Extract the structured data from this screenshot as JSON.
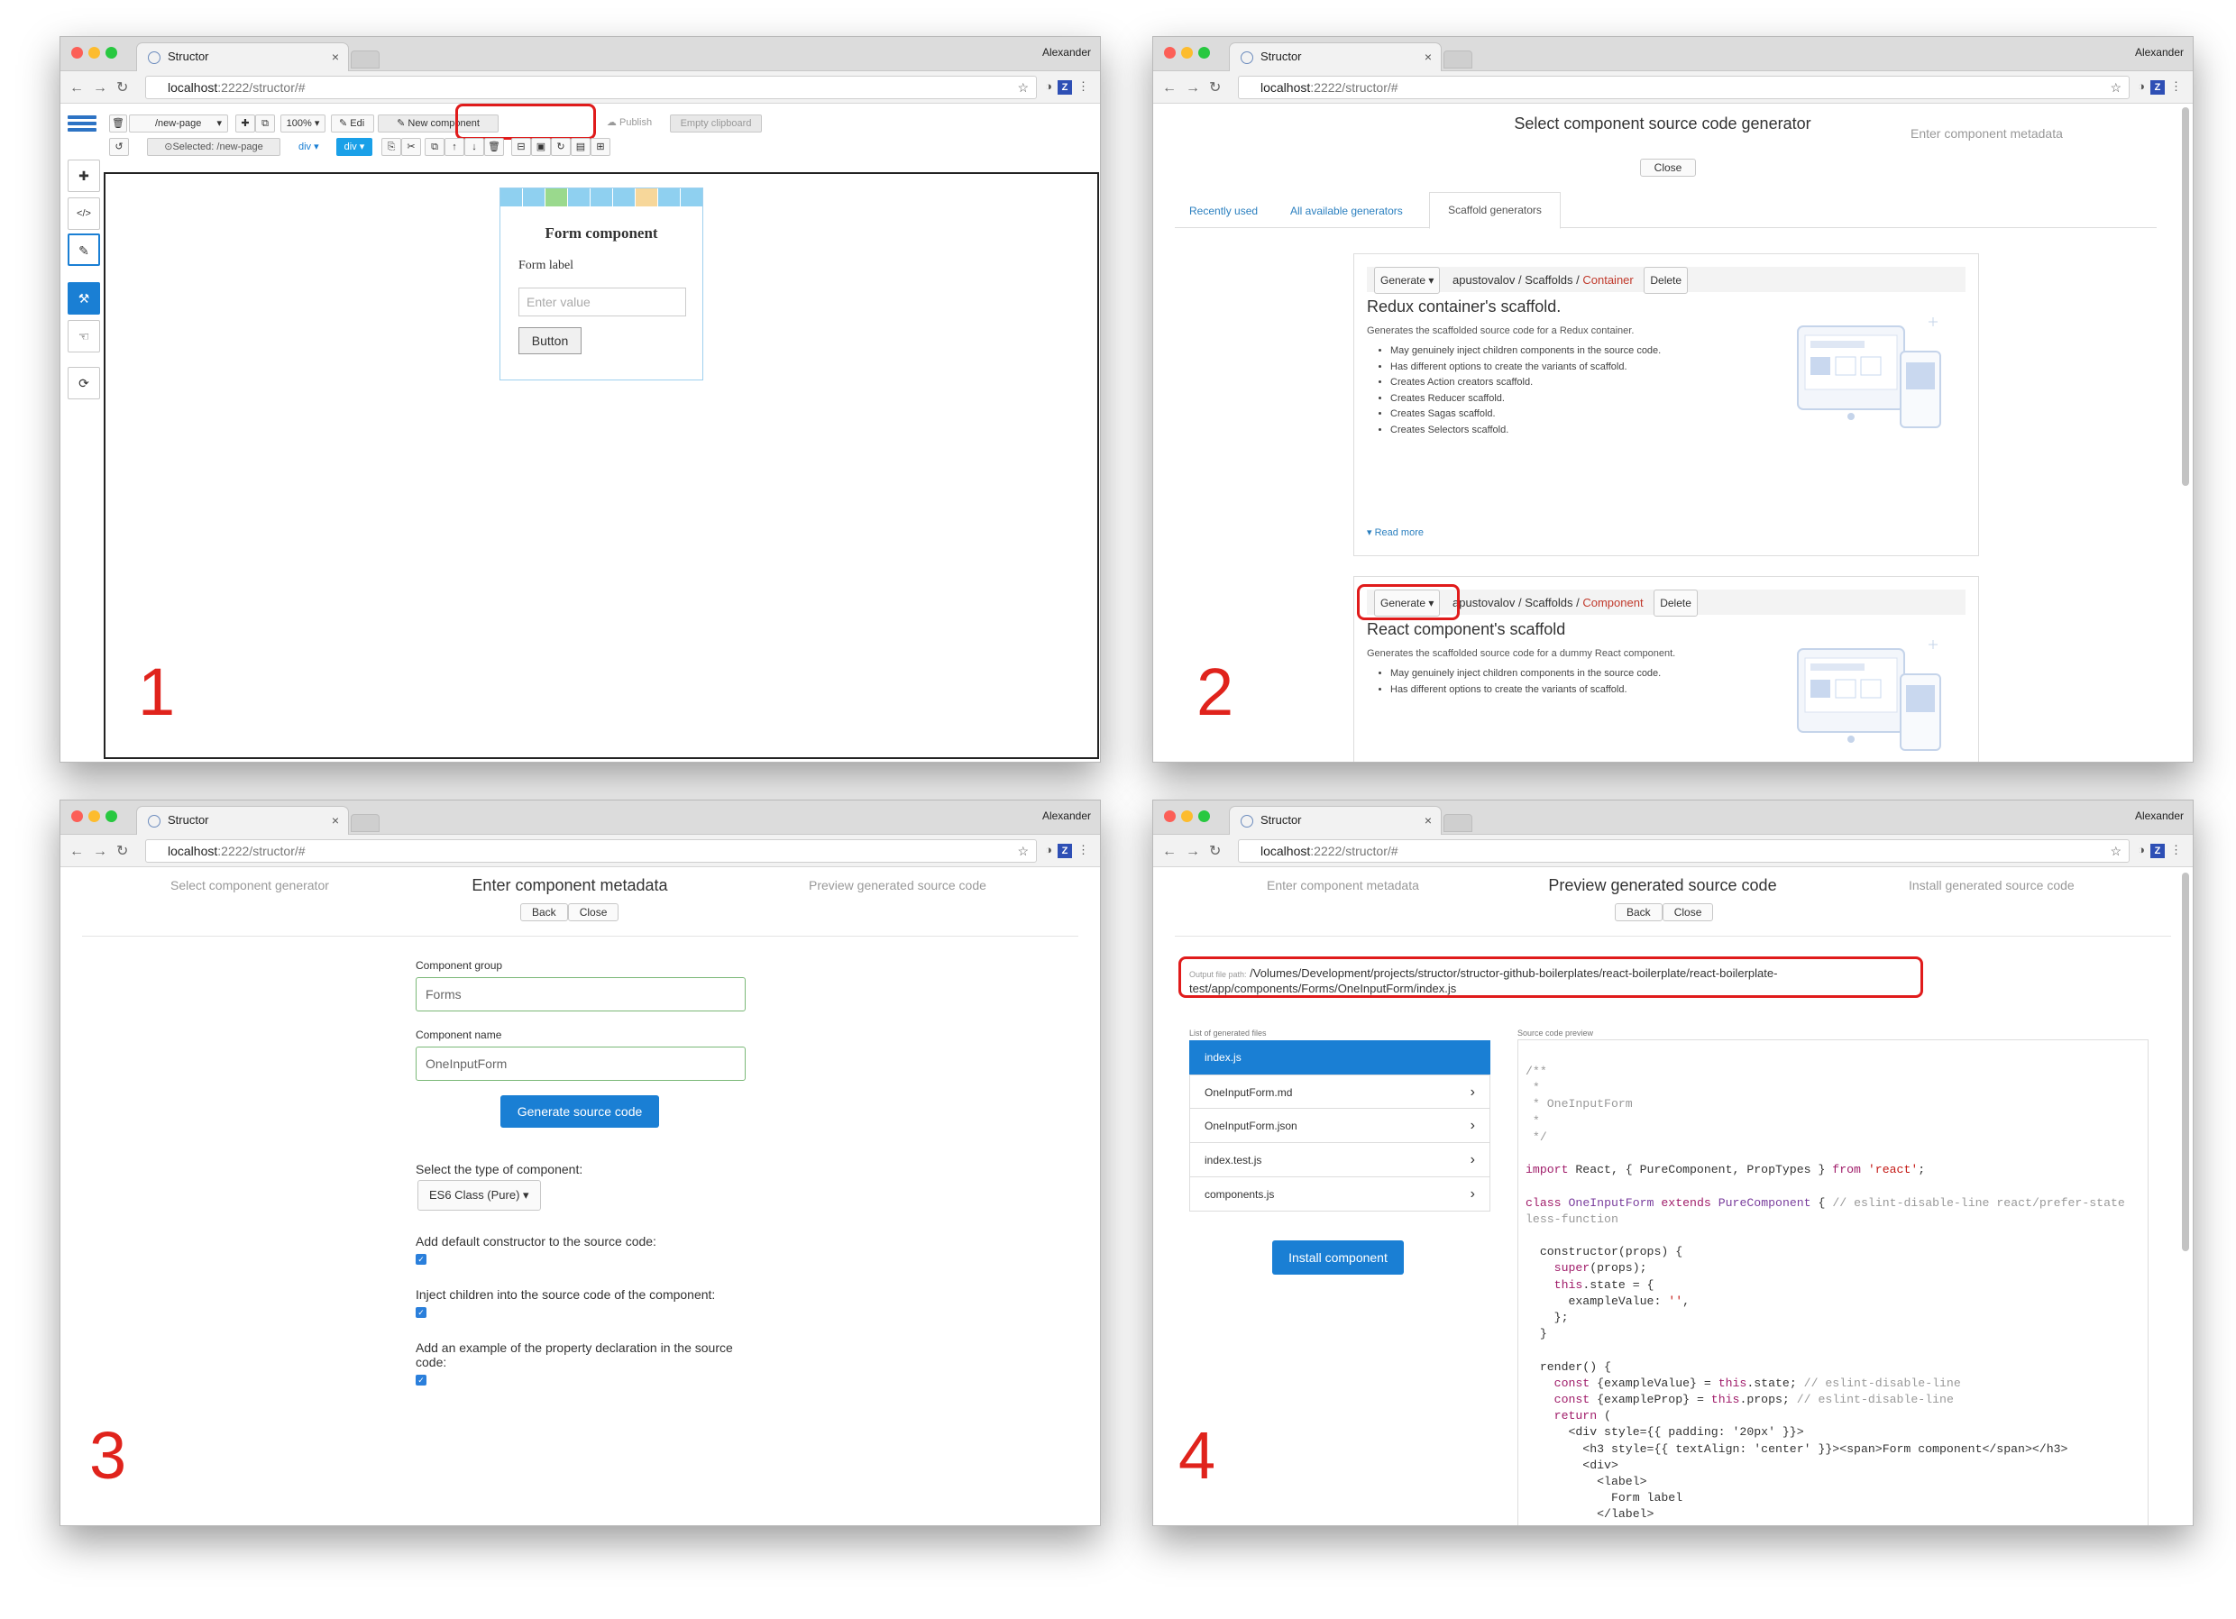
{
  "browser": {
    "tab_title": "Structor",
    "user": "Alexander",
    "url_host": "localhost",
    "url_path": ":2222/structor/#"
  },
  "step_numbers": [
    "1",
    "2",
    "3",
    "4"
  ],
  "window1": {
    "page_select": "/new-page",
    "zoom": "100%",
    "edit_label": "Edi",
    "new_component_label": "New component",
    "publish_label": "Publish",
    "empty_clipboard_label": "Empty clipboard",
    "selected_label": "Selected:",
    "selected_value": "/new-page",
    "crumb_div": "div",
    "crumb_div_active": "div",
    "form": {
      "title": "Form component",
      "label": "Form label",
      "placeholder": "Enter value",
      "button": "Button"
    }
  },
  "window2": {
    "header": {
      "title": "Select component source code generator",
      "next_step": "Enter component metadata",
      "close": "Close"
    },
    "tabs": [
      "Recently used",
      "All available generators",
      "Scaffold generators"
    ],
    "cards": [
      {
        "generate": "Generate",
        "owner": "apustovalov",
        "repo": "Scaffolds",
        "name": "Container",
        "delete": "Delete",
        "title": "Redux container's scaffold.",
        "desc": "Generates the scaffolded source code for a Redux container.",
        "bullets": [
          "May genuinely inject children components in the source code.",
          "Has different options to create the variants of scaffold.",
          "Creates Action creators scaffold.",
          "Creates Reducer scaffold.",
          "Creates Sagas scaffold.",
          "Creates Selectors scaffold."
        ],
        "read_more": "Read more"
      },
      {
        "generate": "Generate",
        "owner": "apustovalov",
        "repo": "Scaffolds",
        "name": "Component",
        "delete": "Delete",
        "title": "React component's scaffold",
        "desc": "Generates the scaffolded source code for a dummy React component.",
        "bullets": [
          "May genuinely inject children components in the source code.",
          "Has different options to create the variants of scaffold."
        ]
      }
    ]
  },
  "window3": {
    "header": {
      "prev_step": "Select component generator",
      "title": "Enter component metadata",
      "next_step": "Preview generated source code",
      "back": "Back",
      "close": "Close"
    },
    "group_label": "Component group",
    "group_value": "Forms",
    "name_label": "Component name",
    "name_value": "OneInputForm",
    "generate_button": "Generate source code",
    "type_label": "Select the type of component:",
    "type_value": "ES6 Class (Pure)",
    "opt1": "Add default constructor to the source code:",
    "opt2": "Inject children into the source code of the component:",
    "opt3": "Add an example of the property declaration in the source code:"
  },
  "window4": {
    "header": {
      "prev_step": "Enter component metadata",
      "title": "Preview generated source code",
      "next_step": "Install generated source code",
      "back": "Back",
      "close": "Close"
    },
    "output_label": "Output file path:",
    "output_path": "/Volumes/Development/projects/structor/structor-github-boilerplates/react-boilerplate/react-boilerplate-test/app/components/Forms/OneInputForm/index.js",
    "files_label": "List of generated files",
    "files": [
      "index.js",
      "OneInputForm.md",
      "OneInputForm.json",
      "index.test.js",
      "components.js"
    ],
    "preview_label": "Source code preview",
    "install_button": "Install component"
  },
  "colors": {
    "accent": "#1a7fd4",
    "highlight": "#e01b1b",
    "input_valid": "#7ab877"
  }
}
